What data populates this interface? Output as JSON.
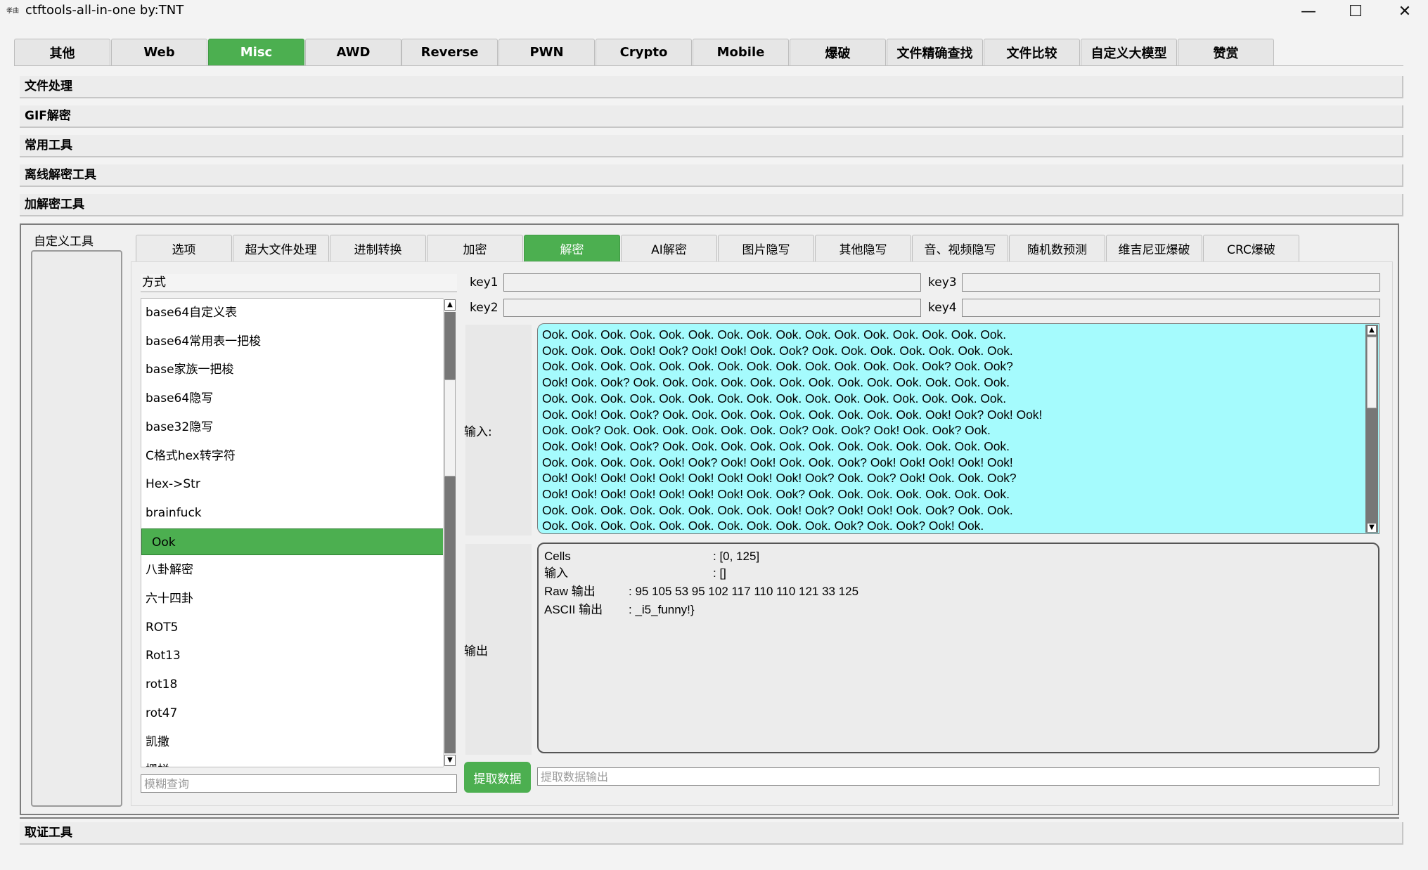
{
  "window": {
    "icon_text": "孝曲",
    "title": "ctftools-all-in-one   by:TNT",
    "minimize_icon": "—",
    "maximize_icon": "☐",
    "close_icon": "✕"
  },
  "main_tabs": [
    "其他",
    "Web",
    "Misc",
    "AWD",
    "Reverse",
    "PWN",
    "Crypto",
    "Mobile",
    "爆破",
    "文件精确查找",
    "文件比较",
    "自定义大模型",
    "赞赏"
  ],
  "main_tab_active": "Misc",
  "sections": [
    "文件处理",
    "GIF解密",
    "常用工具",
    "离线解密工具",
    "加解密工具",
    "取证工具"
  ],
  "custom_tools_label": "自定义工具",
  "sub_tabs": [
    "选项",
    "超大文件处理",
    "进制转换",
    "加密",
    "解密",
    "AI解密",
    "图片隐写",
    "其他隐写",
    "音、视频隐写",
    "随机数预测",
    "维吉尼亚爆破",
    "CRC爆破"
  ],
  "sub_tab_active": "解密",
  "method": {
    "header": "方式",
    "items": [
      "base64自定义表",
      "base64常用表一把梭",
      "base家族一把梭",
      "base64隐写",
      "base32隐写",
      "C格式hex转字符",
      "Hex->Str",
      "brainfuck",
      "Ook",
      "八卦解密",
      "六十四卦",
      "ROT5",
      "Rot13",
      "rot18",
      "rot47",
      "凯撒",
      "栅栏"
    ],
    "selected": "Ook",
    "search_placeholder": "模糊查询"
  },
  "keys": {
    "key1_label": "key1",
    "key1_value": "",
    "key2_label": "key2",
    "key2_value": "",
    "key3_label": "key3",
    "key3_value": "",
    "key4_label": "key4",
    "key4_value": ""
  },
  "input": {
    "label": "输入:",
    "lines": [
      "Ook. Ook. Ook. Ook. Ook. Ook. Ook. Ook. Ook. Ook. Ook. Ook. Ook. Ook. Ook. Ook.",
      "Ook. Ook. Ook. Ook! Ook? Ook! Ook! Ook. Ook? Ook. Ook. Ook. Ook. Ook. Ook. Ook.",
      "Ook. Ook. Ook. Ook. Ook. Ook. Ook. Ook. Ook. Ook. Ook. Ook. Ook. Ook? Ook. Ook?",
      "Ook! Ook. Ook? Ook. Ook. Ook. Ook. Ook. Ook. Ook. Ook. Ook. Ook. Ook. Ook. Ook.",
      "Ook. Ook. Ook. Ook. Ook. Ook. Ook. Ook. Ook. Ook. Ook. Ook. Ook. Ook. Ook. Ook.",
      "Ook. Ook! Ook. Ook? Ook. Ook. Ook. Ook. Ook. Ook. Ook. Ook. Ook. Ook! Ook? Ook! Ook!",
      "Ook. Ook? Ook. Ook. Ook. Ook. Ook. Ook. Ook? Ook. Ook? Ook! Ook. Ook? Ook.",
      "Ook. Ook! Ook. Ook? Ook. Ook. Ook. Ook. Ook. Ook. Ook. Ook. Ook. Ook. Ook. Ook.",
      "Ook. Ook. Ook. Ook. Ook! Ook? Ook! Ook! Ook. Ook. Ook? Ook! Ook! Ook! Ook! Ook!",
      "Ook! Ook! Ook! Ook! Ook! Ook! Ook! Ook! Ook! Ook? Ook. Ook? Ook! Ook. Ook. Ook?",
      "Ook! Ook! Ook! Ook! Ook! Ook! Ook! Ook. Ook? Ook. Ook. Ook. Ook. Ook. Ook. Ook.",
      "Ook. Ook. Ook. Ook. Ook. Ook. Ook. Ook. Ook! Ook? Ook! Ook! Ook. Ook? Ook. Ook.",
      "Ook. Ook. Ook. Ook. Ook. Ook. Ook. Ook. Ook. Ook. Ook? Ook. Ook? Ook! Ook."
    ]
  },
  "output": {
    "label": "输出",
    "rows": [
      {
        "key": "Cells",
        "sep": ": [0, 125]"
      },
      {
        "key": "输入",
        "sep": ": []"
      },
      {
        "key": "Raw 输出",
        "sep": ": 95 105 53 95 102 117 110 110 121 33 125"
      },
      {
        "key": "ASCII 输出",
        "sep": ": _i5_funny!}"
      }
    ]
  },
  "extract": {
    "button_label": "提取数据",
    "output_placeholder": "提取数据输出"
  },
  "colors": {
    "accent": "#4caf50",
    "input_bg": "#a5fbfd"
  }
}
